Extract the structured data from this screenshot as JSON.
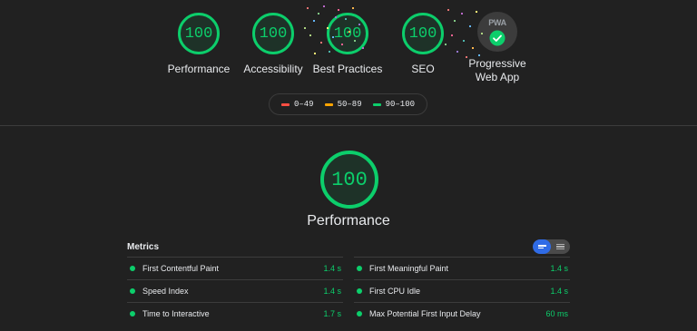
{
  "categories": [
    {
      "score": "100",
      "label": "Performance"
    },
    {
      "score": "100",
      "label": "Accessibility"
    },
    {
      "score": "100",
      "label": "Best Practices"
    },
    {
      "score": "100",
      "label": "SEO"
    }
  ],
  "pwa": {
    "badge_text": "PWA",
    "label_line1": "Progressive",
    "label_line2": "Web App"
  },
  "legend": [
    {
      "range": "0–49",
      "color": "#ff4e42"
    },
    {
      "range": "50–89",
      "color": "#ffa400"
    },
    {
      "range": "90–100",
      "color": "#0cce6b"
    }
  ],
  "performance": {
    "score": "100",
    "title": "Performance"
  },
  "metrics": {
    "heading": "Metrics",
    "left": [
      {
        "label": "First Contentful Paint",
        "value": "1.4 s"
      },
      {
        "label": "Speed Index",
        "value": "1.4 s"
      },
      {
        "label": "Time to Interactive",
        "value": "1.7 s"
      }
    ],
    "right": [
      {
        "label": "First Meaningful Paint",
        "value": "1.4 s"
      },
      {
        "label": "First CPU Idle",
        "value": "1.4 s"
      },
      {
        "label": "Max Potential First Input Delay",
        "value": "60 ms"
      }
    ]
  },
  "colors": {
    "pass": "#0cce6b",
    "toggle_active": "#2f6be6"
  }
}
